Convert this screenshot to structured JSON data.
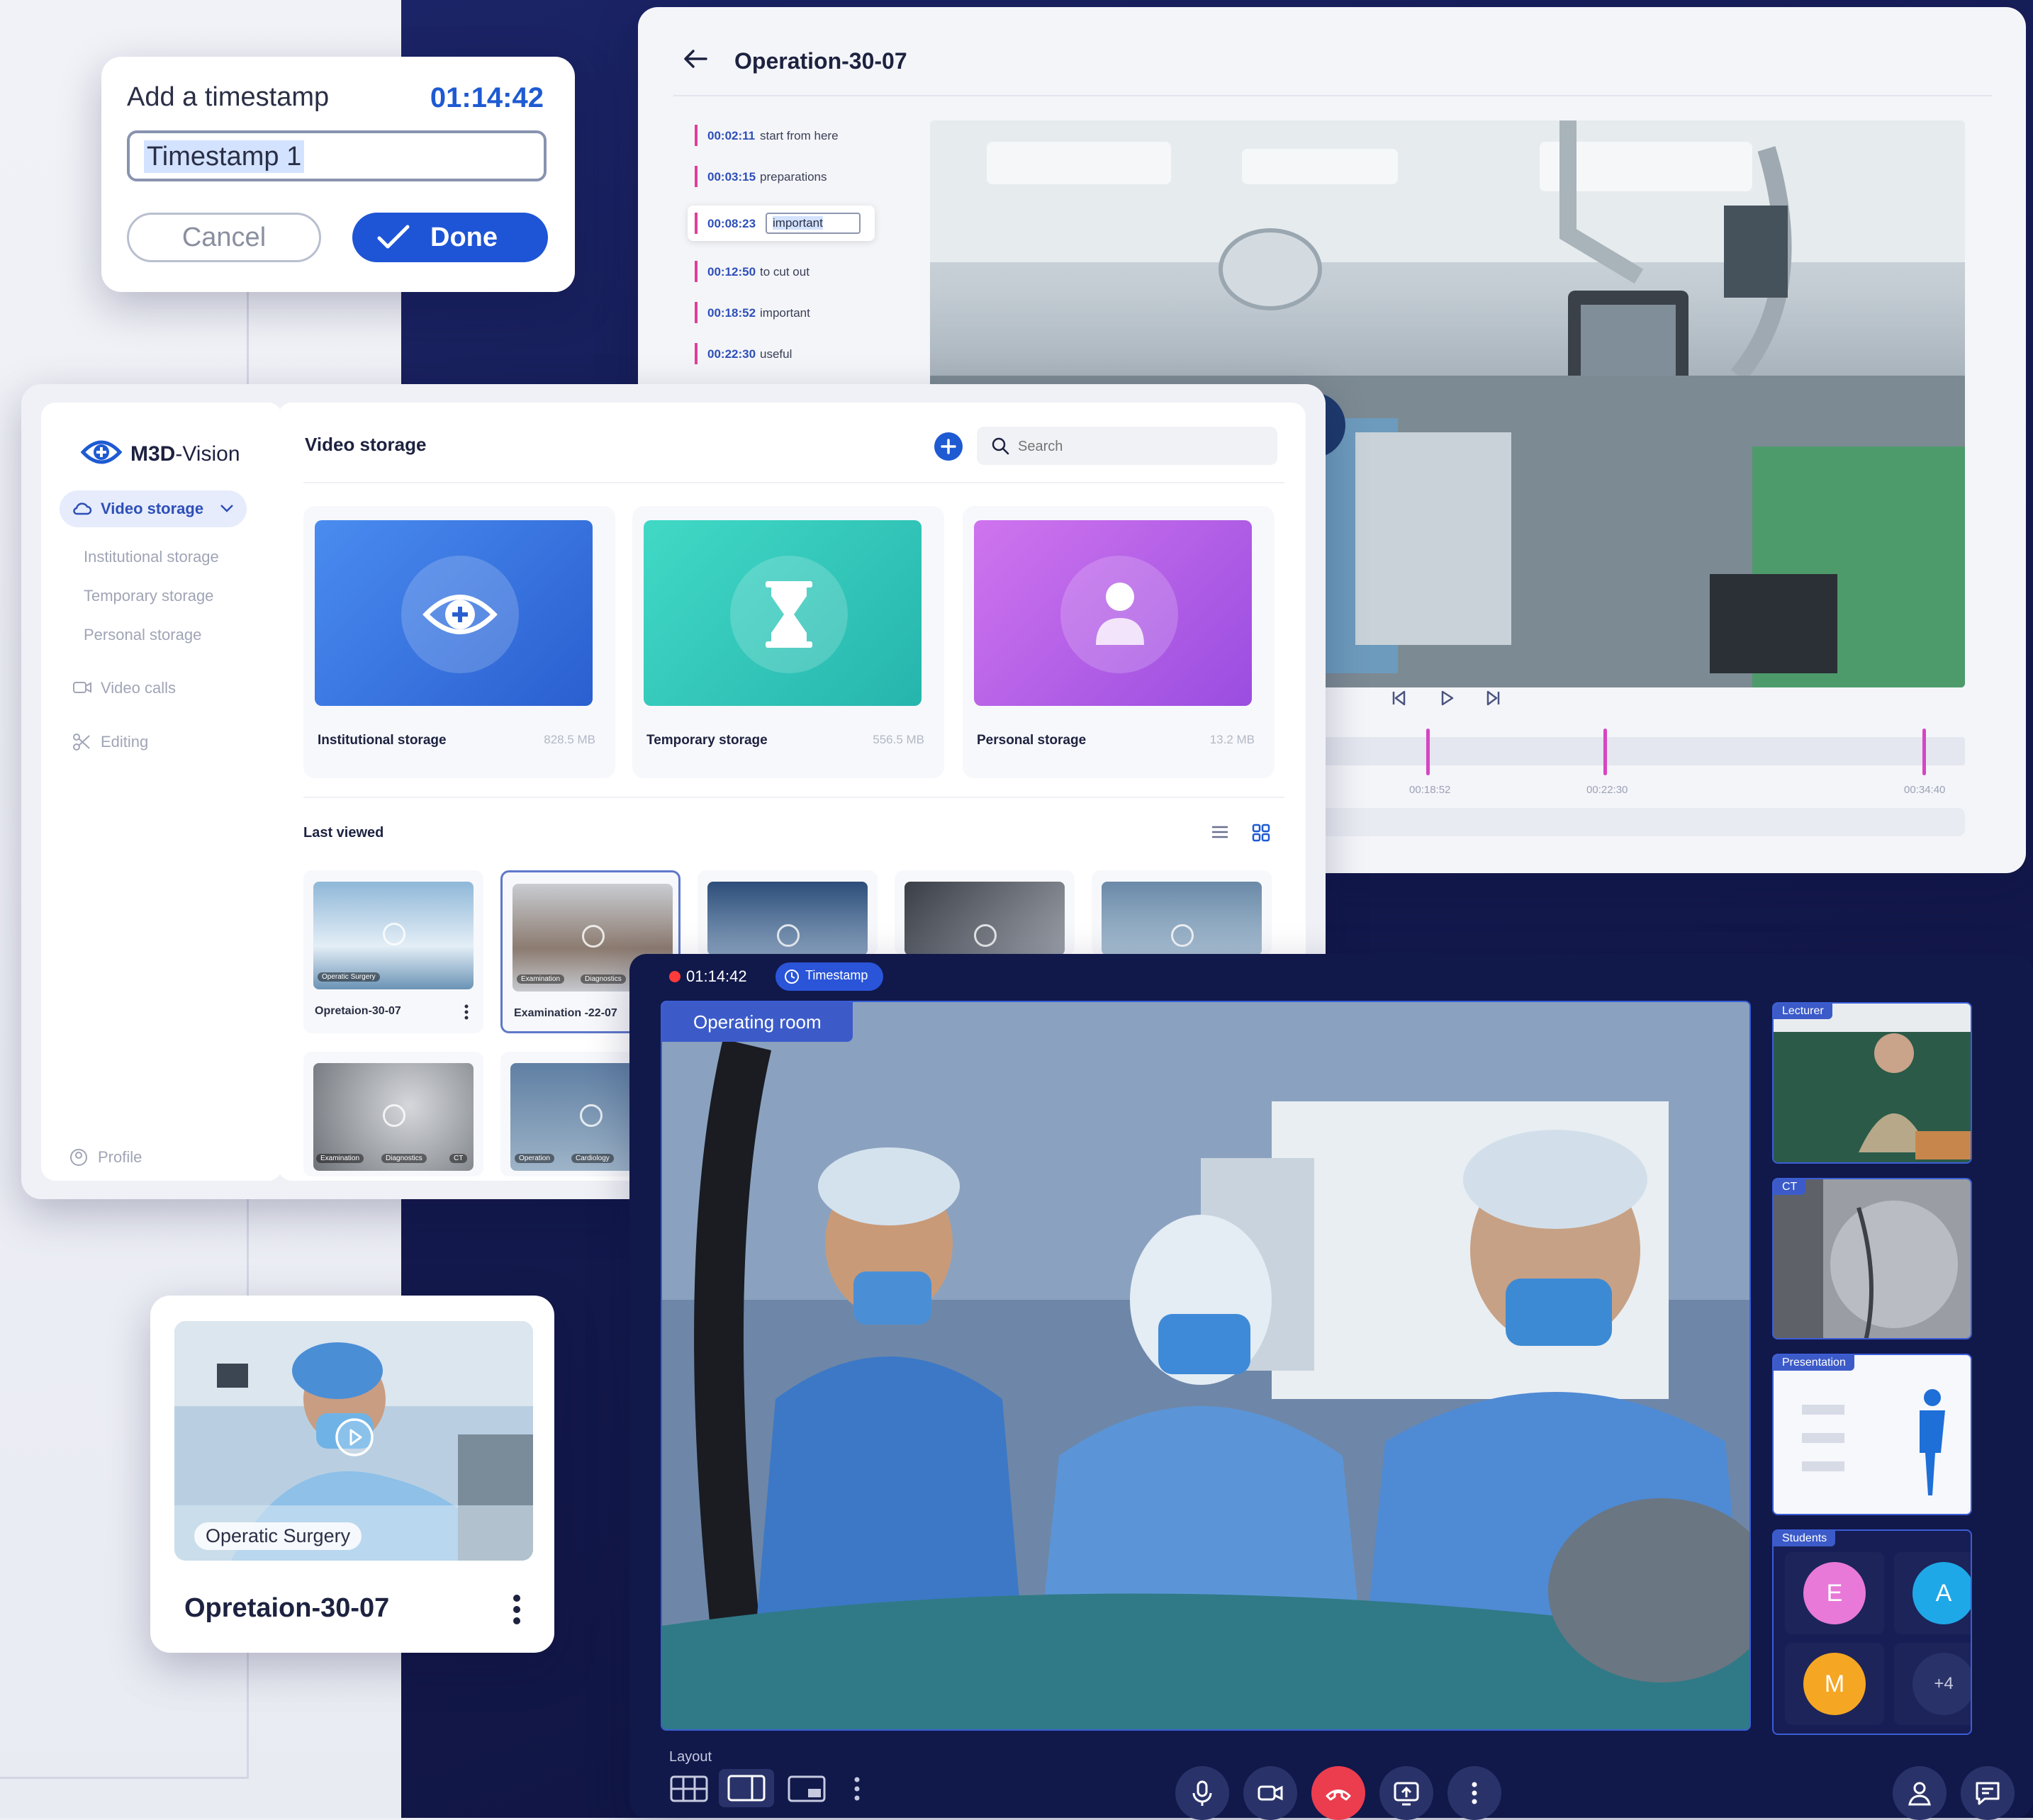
{
  "timestamp_dialog": {
    "title": "Add a timestamp",
    "time": "01:14:42",
    "input_value": "Timestamp 1",
    "cancel_label": "Cancel",
    "done_label": "Done"
  },
  "operation_player": {
    "title": "Operation-30-07",
    "timestamps": [
      {
        "time": "00:02:11",
        "label": "start from here"
      },
      {
        "time": "00:03:15",
        "label": "preparations"
      },
      {
        "time": "00:08:23",
        "label": "important",
        "editing": true
      },
      {
        "time": "00:12:50",
        "label": "to cut out"
      },
      {
        "time": "00:18:52",
        "label": "important"
      },
      {
        "time": "00:22:30",
        "label": "useful"
      }
    ],
    "marker_labels": [
      "00:18:52",
      "00:22:30",
      "00:34:40"
    ]
  },
  "storage_app": {
    "brand_bold": "M3D",
    "brand_rest": "-Vision",
    "nav": {
      "video_storage": "Video storage",
      "institutional": "Institutional storage",
      "temporary": "Temporary storage",
      "personal": "Personal storage",
      "video_calls": "Video calls",
      "editing": "Editing",
      "profile": "Profile"
    },
    "title": "Video storage",
    "search_placeholder": "Search",
    "cards": [
      {
        "name": "Institutional storage",
        "size": "828.5 MB",
        "color_from": "#3f7fe6",
        "color_to": "#2a5fd0"
      },
      {
        "name": "Temporary storage",
        "size": "556.5 MB",
        "color_from": "#38d2c0",
        "color_to": "#25b9b0"
      },
      {
        "name": "Personal storage",
        "size": "13.2 MB",
        "color_from": "#c86bea",
        "color_to": "#9e4fe0"
      }
    ],
    "last_viewed_label": "Last viewed",
    "videos": [
      {
        "title": "Opretaion-30-07",
        "tags": [
          "Operatic Surgery"
        ]
      },
      {
        "title": "Examination -22-07",
        "tags": [
          "Examination",
          "Diagnostics"
        ]
      },
      {
        "title": "",
        "tags": []
      },
      {
        "title": "",
        "tags": []
      },
      {
        "title": "",
        "tags": []
      },
      {
        "title": "",
        "tags": [
          "Examination",
          "Diagnostics",
          "CT"
        ]
      },
      {
        "title": "",
        "tags": [
          "Operation",
          "Cardiology"
        ]
      }
    ]
  },
  "video_call": {
    "rec_time": "01:14:42",
    "timestamp_label": "Timestamp",
    "main_label": "Operating room",
    "tiles": {
      "lecturer": "Lecturer",
      "ct": "CT",
      "presentation": "Presentation",
      "students": "Students"
    },
    "students": [
      {
        "initial": "E",
        "color": "#e879d8"
      },
      {
        "initial": "A",
        "color": "#1fa8e8"
      },
      {
        "initial": "M",
        "color": "#f5a623"
      },
      {
        "initial": "+4",
        "color": "#2a3369"
      }
    ],
    "layout_label": "Layout"
  },
  "video_card": {
    "tag": "Operatic Surgery",
    "title": "Opretaion-30-07"
  }
}
